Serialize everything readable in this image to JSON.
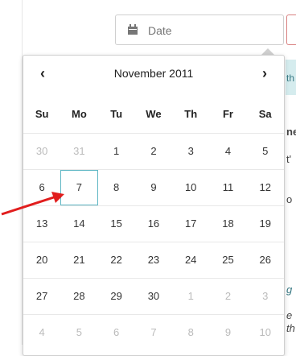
{
  "date_field": {
    "placeholder": "Date",
    "icon": "calendar-icon"
  },
  "background_fragments": [
    "th",
    "ne",
    "t'",
    "o",
    "g",
    "e",
    "th"
  ],
  "calendar": {
    "title": "November 2011",
    "prev_label": "‹",
    "next_label": "›",
    "weekdays": [
      "Su",
      "Mo",
      "Tu",
      "We",
      "Th",
      "Fr",
      "Sa"
    ],
    "weeks": [
      [
        "30",
        "31",
        "1",
        "2",
        "3",
        "4",
        "5"
      ],
      [
        "6",
        "7",
        "8",
        "9",
        "10",
        "11",
        "12"
      ],
      [
        "13",
        "14",
        "15",
        "16",
        "17",
        "18",
        "19"
      ],
      [
        "20",
        "21",
        "22",
        "23",
        "24",
        "25",
        "26"
      ],
      [
        "27",
        "28",
        "29",
        "30",
        "1",
        "2",
        "3"
      ],
      [
        "4",
        "5",
        "6",
        "7",
        "8",
        "9",
        "10"
      ]
    ],
    "highlighted_day": "7",
    "accent_color": "#5fb7c4",
    "annotation_color": "#e11d1d"
  }
}
